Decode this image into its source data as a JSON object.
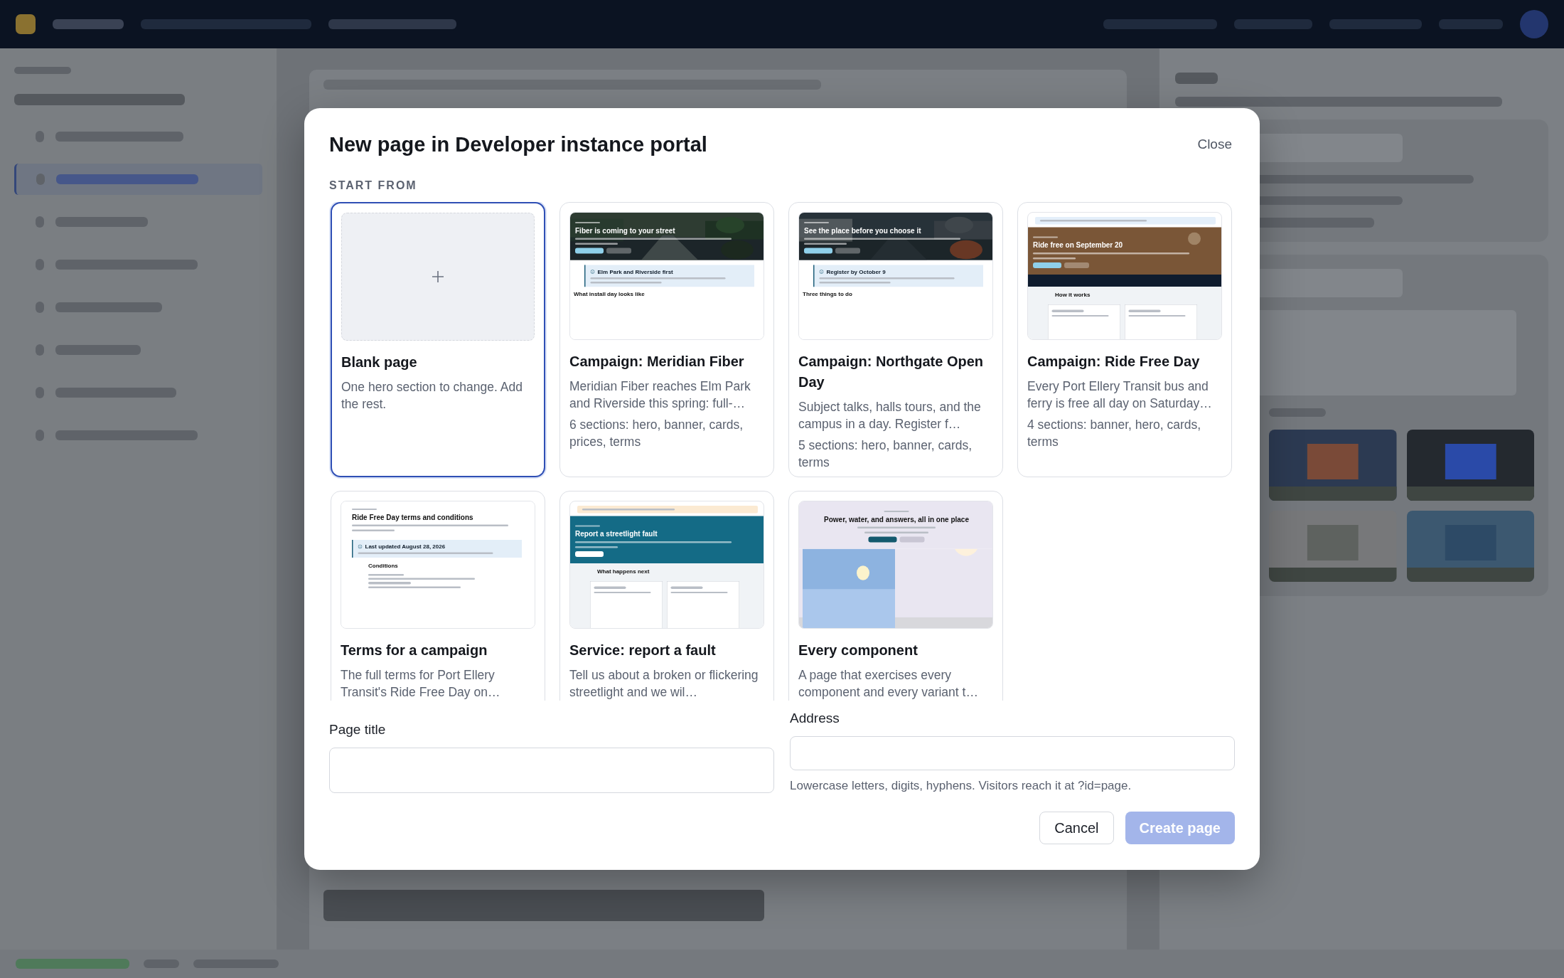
{
  "dialog": {
    "title": "New page in Developer instance portal",
    "close": "Close",
    "section_label": "START FROM",
    "templates": [
      {
        "title": "Blank page",
        "description": "One hero section to change. Add the rest.",
        "selected": true,
        "preview": {
          "kind": "blank"
        }
      },
      {
        "title": "Campaign: Meridian Fiber",
        "description": "Meridian Fiber reaches Elm Park and Riverside this spring: full-…",
        "sections": "6 sections: hero, banner, cards, prices, terms",
        "selected": false,
        "preview": {
          "heading": "Fiber is coming to your street",
          "callout": "Elm Park and Riverside first",
          "section": "What install day looks like"
        }
      },
      {
        "title": "Campaign: Northgate Open Day",
        "description": "Subject talks, halls tours, and the campus in a day. Register f…",
        "sections": "5 sections: hero, banner, cards, terms",
        "selected": false,
        "preview": {
          "heading": "See the place before you choose it",
          "callout": "Register by October 9",
          "section": "Three things to do"
        }
      },
      {
        "title": "Campaign: Ride Free Day",
        "description": "Every Port Ellery Transit bus and ferry is free all day on Saturday…",
        "sections": "4 sections: banner, hero, cards, terms",
        "selected": false,
        "preview": {
          "kind": "brown",
          "heading": "Ride free on September 20",
          "section": "How it works"
        }
      },
      {
        "title": "Terms for a campaign",
        "description": "The full terms for Port Ellery Transit's Ride Free Day on…",
        "selected": false,
        "preview": {
          "kind": "plain",
          "heading": "Ride Free Day terms and conditions",
          "callout": "Last updated August 28, 2026",
          "section": "Conditions"
        }
      },
      {
        "title": "Service: report a fault",
        "description": "Tell us about a broken or flickering streetlight and we wil…",
        "selected": false,
        "preview": {
          "kind": "teal",
          "heading": "Report a streetlight fault",
          "section": "What happens next"
        }
      },
      {
        "title": "Every component",
        "description": "A page that exercises every component and every variant t…",
        "selected": false,
        "preview": {
          "kind": "lavender",
          "heading": "Power, water, and answers, all in one place"
        }
      }
    ],
    "fields": [
      {
        "label": "Page title"
      },
      {
        "label": "Address",
        "hint": "Lowercase letters, digits, hyphens. Visitors reach it at ?id=page."
      }
    ],
    "buttons": [
      {
        "label": "Cancel",
        "kind": "secondary",
        "disabled": false
      },
      {
        "label": "Create page",
        "kind": "primary",
        "disabled": true
      }
    ]
  }
}
